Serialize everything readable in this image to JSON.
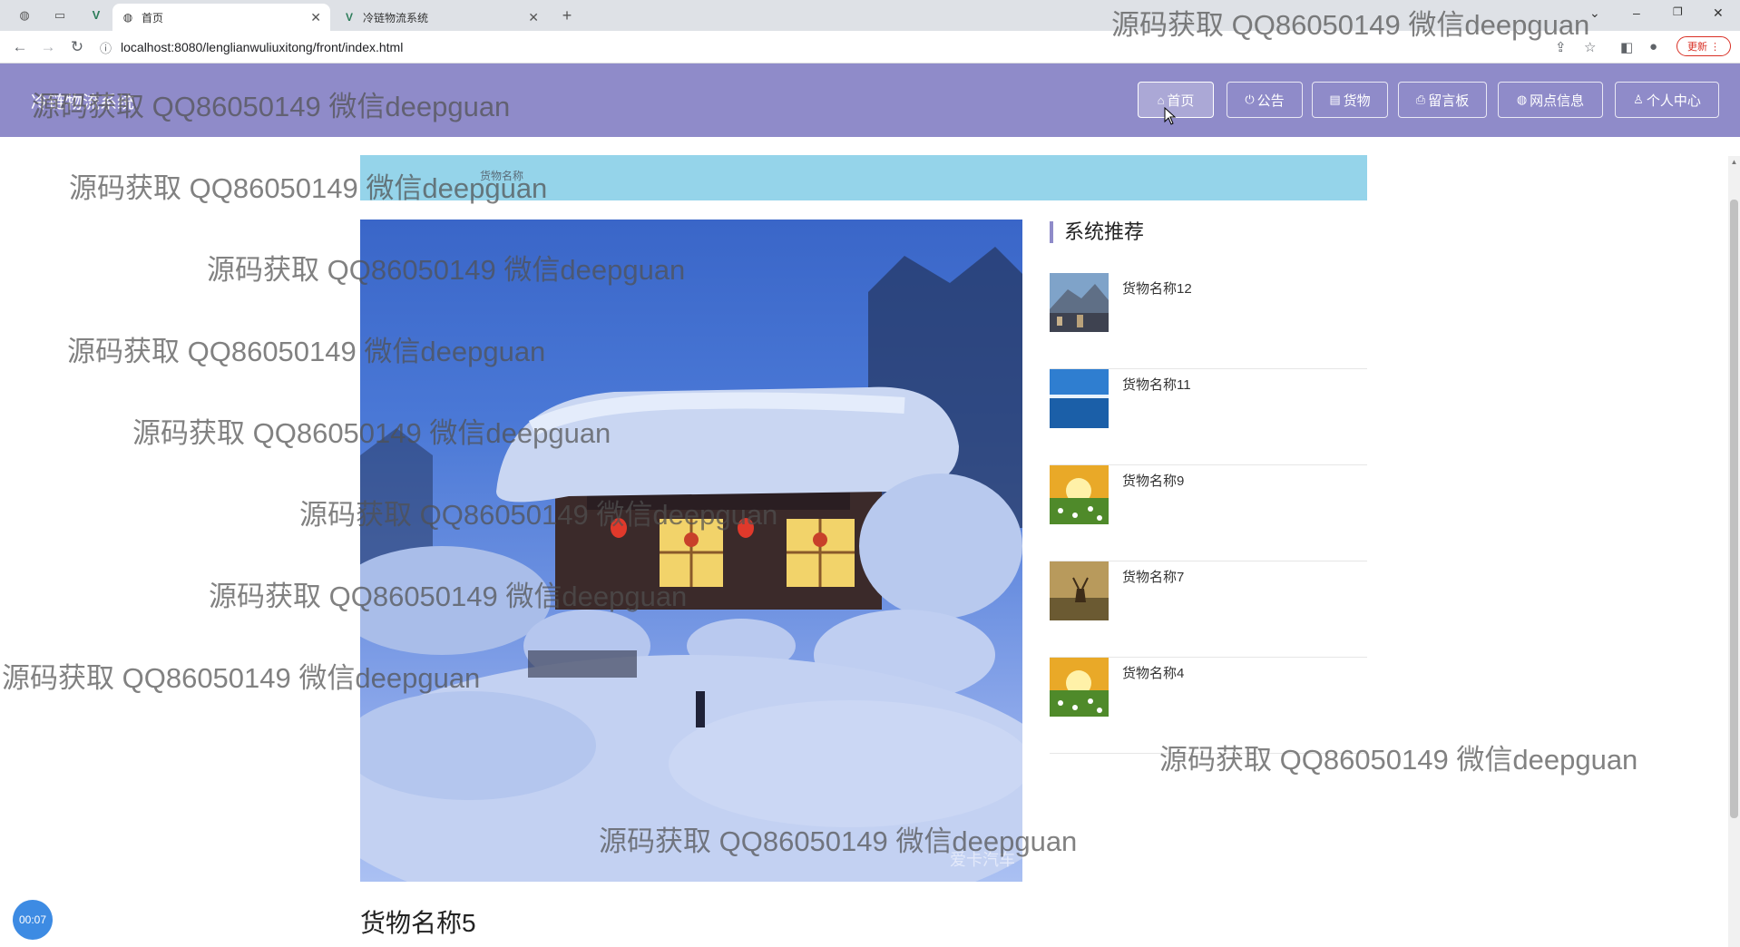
{
  "browser": {
    "tabs": [
      {
        "title": "首页",
        "active": true
      },
      {
        "title": "冷链物流系统",
        "active": false
      }
    ],
    "new_tab_symbol": "+",
    "url": "localhost:8080/lenglianwuliuxitong/front/index.html",
    "update_button": "更新"
  },
  "site": {
    "title": "冷链物流系统",
    "nav": [
      {
        "label": "首页",
        "icon": "home-icon",
        "glyph": "⌂"
      },
      {
        "label": "公告",
        "icon": "power-icon",
        "glyph": "⏻"
      },
      {
        "label": "货物",
        "icon": "document-icon",
        "glyph": "▤"
      },
      {
        "label": "留言板",
        "icon": "printer-icon",
        "glyph": "⎙"
      },
      {
        "label": "网点信息",
        "icon": "globe-icon",
        "glyph": "◍"
      },
      {
        "label": "个人中心",
        "icon": "user-icon",
        "glyph": "♙"
      }
    ],
    "accent_color": "#8f8bc9"
  },
  "search": {
    "label": "货物名称"
  },
  "recommend": {
    "title": "系统推荐",
    "items": [
      {
        "name": "货物名称12",
        "thumb": "city"
      },
      {
        "name": "货物名称11",
        "thumb": "sea"
      },
      {
        "name": "货物名称9",
        "thumb": "flowers"
      },
      {
        "name": "货物名称7",
        "thumb": "deer"
      },
      {
        "name": "货物名称4",
        "thumb": "flowers"
      }
    ]
  },
  "product": {
    "title": "货物名称5",
    "image_watermark": "爱卡汽车"
  },
  "recorder": {
    "time": "00:07"
  },
  "watermark_text": "源码获取 QQ86050149 微信deepguan"
}
